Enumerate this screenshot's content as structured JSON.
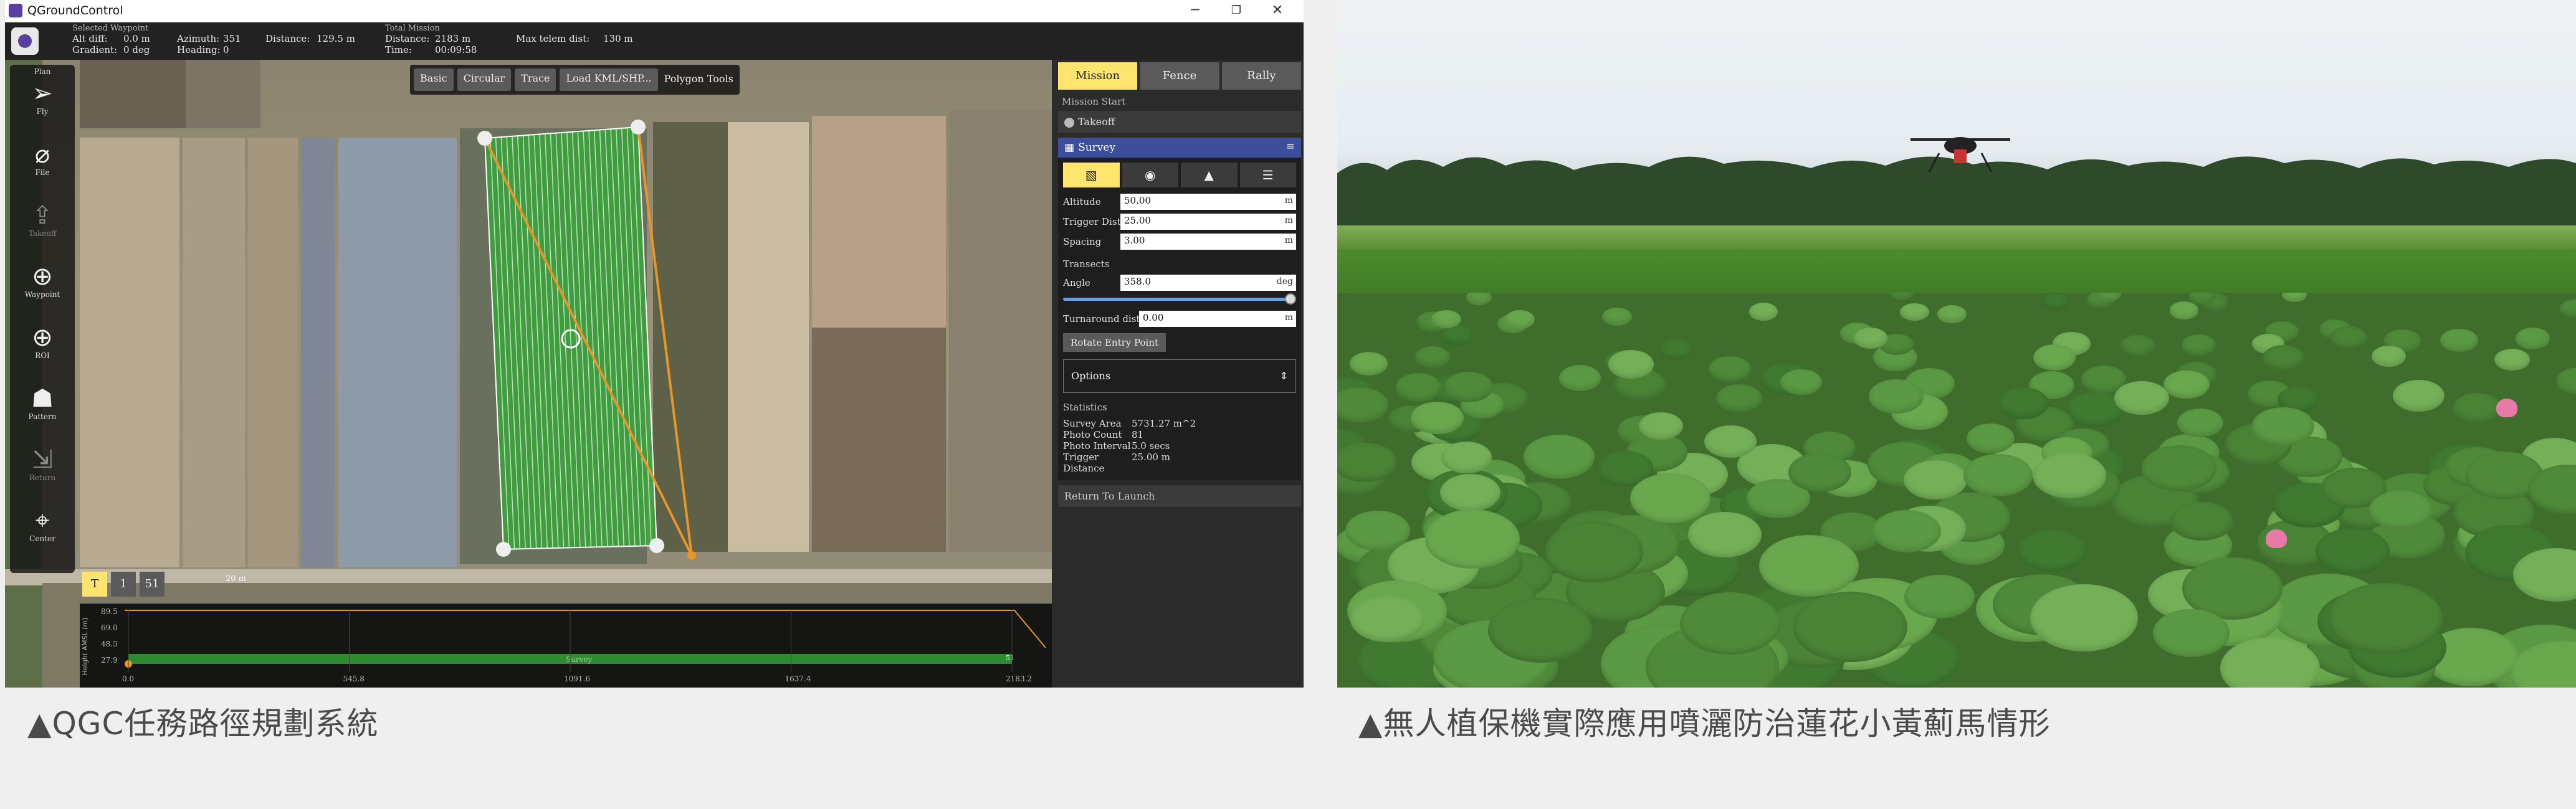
{
  "window": {
    "title": "QGroundControl",
    "controls": {
      "minimize": "─",
      "restore": "❐",
      "close": "✕"
    }
  },
  "toolbar": {
    "selected_waypoint_heading": "Selected Waypoint",
    "alt_diff_label": "Alt diff:",
    "alt_diff_value": "0.0 m",
    "gradient_label": "Gradient:",
    "gradient_value": "0 deg",
    "azimuth_label": "Azimuth:",
    "azimuth_value": "351",
    "heading_label": "Heading:",
    "heading_value": "0",
    "distance_label": "Distance:",
    "distance_value": "129.5 m",
    "total_mission_heading": "Total Mission",
    "total_distance_label": "Distance:",
    "total_distance_value": "2183 m",
    "time_label": "Time:",
    "time_value": "00:09:58",
    "max_telem_label": "Max telem dist:",
    "max_telem_value": "130 m"
  },
  "left_tools": [
    {
      "label": "Plan",
      "glyph": "",
      "icon": "plan-header"
    },
    {
      "label": "Fly",
      "glyph": "➢",
      "icon": "paper-plane-icon"
    },
    {
      "label": "File",
      "glyph": "⌀",
      "icon": "file-icon"
    },
    {
      "label": "Takeoff",
      "glyph": "⇪",
      "icon": "takeoff-icon"
    },
    {
      "label": "Waypoint",
      "glyph": "⊕",
      "icon": "waypoint-icon"
    },
    {
      "label": "ROI",
      "glyph": "⊕",
      "icon": "roi-icon"
    },
    {
      "label": "Pattern",
      "glyph": "☗",
      "icon": "pattern-icon"
    },
    {
      "label": "Return",
      "glyph": "⇲",
      "icon": "return-icon"
    },
    {
      "label": "Center",
      "glyph": "⌖",
      "icon": "center-icon"
    }
  ],
  "pattern_tools": {
    "basic": "Basic",
    "circular": "Circular",
    "trace": "Trace",
    "load_kml": "Load KML/SHP...",
    "label": "Polygon Tools"
  },
  "right_panel": {
    "tabs": [
      "Mission",
      "Fence",
      "Rally"
    ],
    "mission_start": "Mission Start",
    "takeoff_item": "Takeoff",
    "survey_title": "Survey",
    "fields": {
      "altitude_label": "Altitude",
      "altitude_value": "50.00",
      "altitude_unit": "m",
      "trigger_dist_label": "Trigger Dist",
      "trigger_dist_value": "25.00",
      "trigger_dist_unit": "m",
      "spacing_label": "Spacing",
      "spacing_value": "3.00",
      "spacing_unit": "m"
    },
    "transects": {
      "title": "Transects",
      "angle_label": "Angle",
      "angle_value": "358.0",
      "angle_unit": "deg",
      "angle_fraction": 0.994,
      "turnaround_label": "Turnaround dist",
      "turnaround_value": "0.00",
      "turnaround_unit": "m",
      "rotate_button": "Rotate Entry Point"
    },
    "options_label": "Options",
    "statistics": {
      "title": "Statistics",
      "rows": [
        {
          "k": "Survey Area",
          "v": "5731.27 m^2"
        },
        {
          "k": "Photo Count",
          "v": "81"
        },
        {
          "k": "Photo Interval",
          "v": "5.0 secs"
        },
        {
          "k": "Trigger Distance",
          "v": "25.00 m"
        }
      ]
    },
    "return_to_launch": "Return To Launch"
  },
  "terrain": {
    "y_axis_label": "Height AMSL (m)",
    "y_ticks": [
      "89.5",
      "69.0",
      "48.5",
      "27.9"
    ],
    "x_ticks": [
      "0.0",
      "545.8",
      "1091.6",
      "1637.4",
      "2183.2"
    ],
    "x_tick_values": [
      0.0,
      545.8,
      1091.6,
      1637.4,
      2183.2
    ],
    "x_max": 2183.2,
    "survey_label": "Survey",
    "waypoint_marker": "51",
    "chips": [
      "T",
      "1",
      "51"
    ]
  },
  "map": {
    "scale_label": "20 m"
  },
  "colors": {
    "accent": "#ffe56d",
    "survey_header": "#3c4d9c",
    "survey_polygon": "#3aa53a",
    "path": "#e8952a"
  },
  "captions": {
    "left": "▲QGC任務路徑規劃系統",
    "right": "▲無人植保機實際應用噴灑防治蓮花小黃薊馬情形"
  }
}
